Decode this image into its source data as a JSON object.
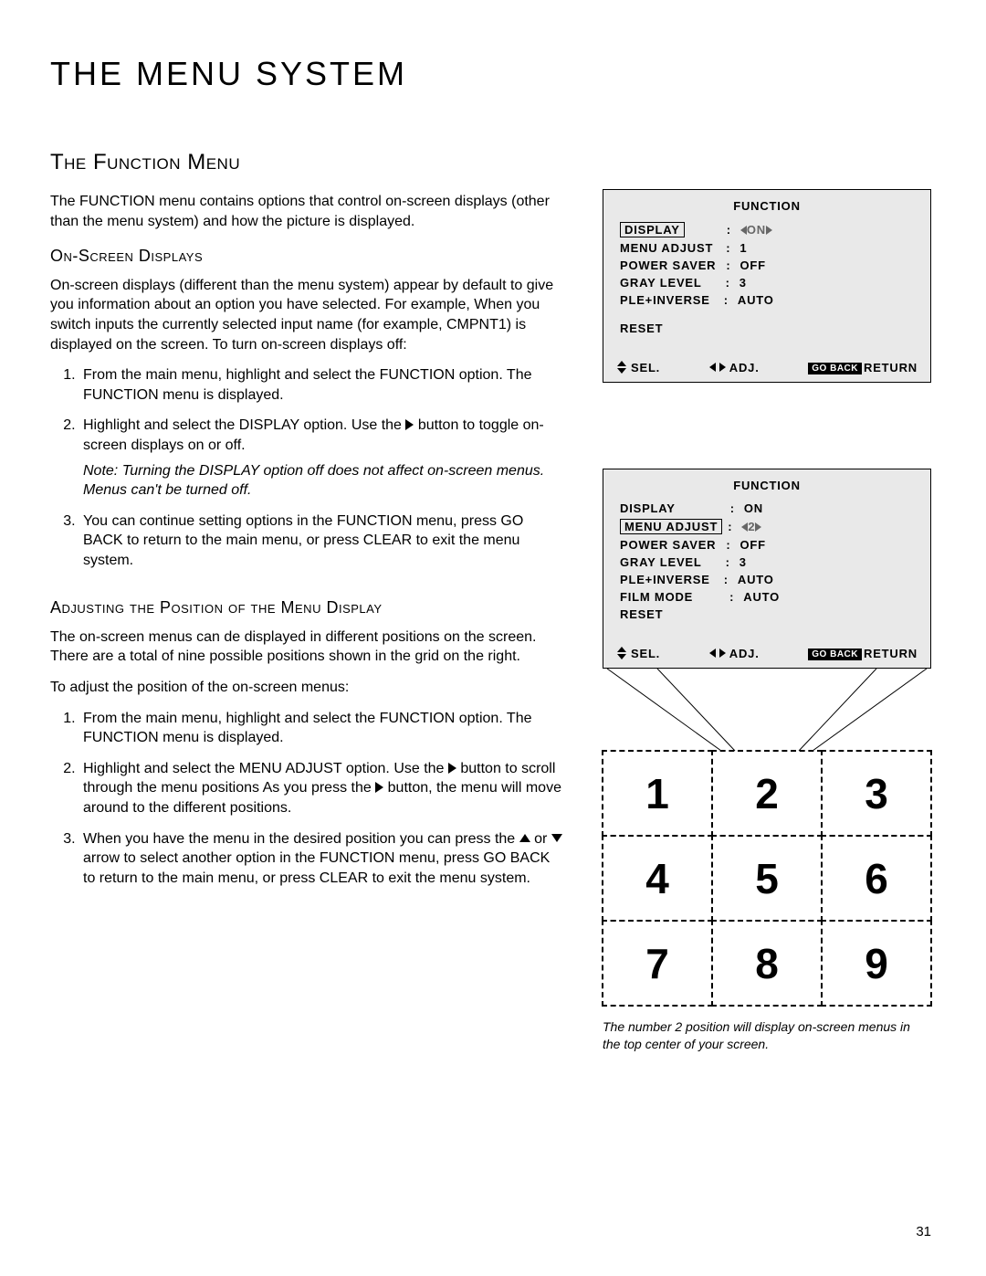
{
  "page_title": "THE MENU SYSTEM",
  "section_title": "The Function Menu",
  "intro": "The FUNCTION menu contains options that control on-screen displays (other than the menu system) and how the picture is displayed.",
  "sub1_title": "On-Screen Displays",
  "sub1_para": "On-screen displays (different than the menu system) appear by default to give you information about an option you have selected. For example, When you switch inputs the currently selected input name (for example, CMPNT1) is displayed on the screen. To turn on-screen displays off:",
  "sub1_step1": "From the main menu, highlight and select the FUNCTION option. The FUNCTION menu is displayed.",
  "sub1_step2a": "Highlight and select the DISPLAY option. Use the ",
  "sub1_step2b": " button to toggle on-screen displays on or off.",
  "sub1_note": "Note: Turning the DISPLAY option off does not affect on-screen menus. Menus can't be turned off.",
  "sub1_step3": "You can continue setting options in the FUNCTION menu, press GO BACK to return to the main menu, or press CLEAR to exit the menu system.",
  "sub2_title": "Adjusting the Position of the Menu Display",
  "sub2_para1": "The on-screen menus can de displayed in different positions on the screen. There are a total of nine possible positions shown in the grid on the right.",
  "sub2_para2": "To adjust the position of the on-screen menus:",
  "sub2_step1": "From the main menu, highlight and select the FUNCTION option. The FUNCTION menu is displayed.",
  "sub2_step2a": "Highlight and select the MENU ADJUST option. Use the ",
  "sub2_step2b": " button to scroll through the menu positions As you press the ",
  "sub2_step2c": " button, the menu will move around to the different positions.",
  "sub2_step3a": "When you have the menu in the desired position you can press the ",
  "sub2_step3b": " or ",
  "sub2_step3c": " arrow to select another option in the FUNCTION menu, press GO BACK to return to the main menu, or press CLEAR to exit the menu system.",
  "osd1": {
    "title": "FUNCTION",
    "rows": [
      {
        "label": "DISPLAY",
        "boxed": true,
        "value": "ON",
        "arrows": true
      },
      {
        "label": "MENU ADJUST",
        "value": "1"
      },
      {
        "label": "POWER SAVER",
        "value": "OFF"
      },
      {
        "label": "GRAY LEVEL",
        "value": "3"
      },
      {
        "label": "PLE+INVERSE",
        "value": "AUTO"
      }
    ],
    "reset": "RESET",
    "sel": "SEL.",
    "adj": "ADJ.",
    "goback": "GO BACK",
    "return": "RETURN"
  },
  "osd2": {
    "title": "FUNCTION",
    "rows": [
      {
        "label": "DISPLAY",
        "value": "ON"
      },
      {
        "label": "MENU ADJUST",
        "boxed": true,
        "value": "2",
        "arrows": true
      },
      {
        "label": "POWER SAVER",
        "value": "OFF"
      },
      {
        "label": "GRAY LEVEL",
        "value": "3"
      },
      {
        "label": "PLE+INVERSE",
        "value": "AUTO"
      },
      {
        "label": "FILM MODE",
        "value": "AUTO"
      }
    ],
    "reset": "RESET",
    "sel": "SEL.",
    "adj": "ADJ.",
    "goback": "GO BACK",
    "return": "RETURN"
  },
  "grid": [
    "1",
    "2",
    "3",
    "4",
    "5",
    "6",
    "7",
    "8",
    "9"
  ],
  "caption": "The number 2 position will display on-screen menus in the top center of your screen.",
  "page_number": "31"
}
